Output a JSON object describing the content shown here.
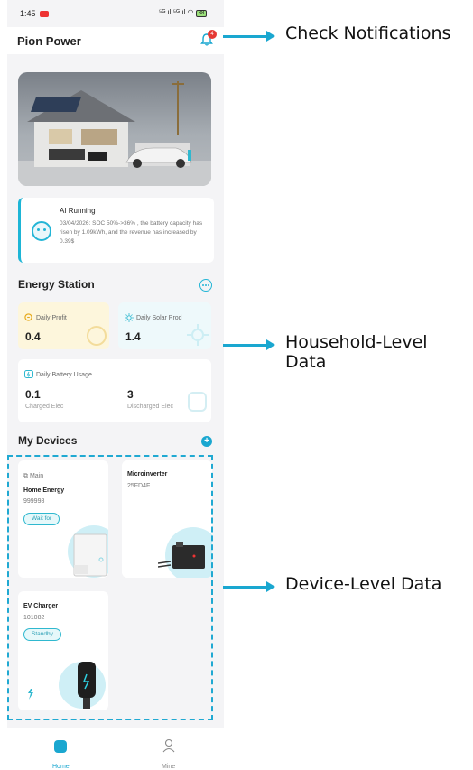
{
  "status_bar": {
    "time": "1:45",
    "dots": "···",
    "signal": "⁵ᴳ.ıl ⁵ᴳ.ıl",
    "battery": "38"
  },
  "app": {
    "title": "Pion Power",
    "notification_count": "4"
  },
  "ai": {
    "title": "AI Running",
    "description": "03/04/2026: SOC 50%->36% , the battery capacity has risen by 1.09kWh, and the revenue has increased by 0.39$"
  },
  "energy_station": {
    "title": "Energy Station",
    "daily_profit": {
      "label": "Daily Profit",
      "value": "0.4"
    },
    "daily_solar": {
      "label": "Daily Solar Prod",
      "value": "1.4"
    },
    "battery_usage": {
      "label": "Daily Battery Usage",
      "charged": {
        "value": "0.1",
        "label": "Charged Elec"
      },
      "discharged": {
        "value": "3",
        "label": "Discharged Elec"
      }
    }
  },
  "devices": {
    "title": "My Devices",
    "items": [
      {
        "tag": "Main",
        "name": "Home Energy",
        "sn": "999998",
        "status": "Wait for"
      },
      {
        "name": "Microinverter",
        "sn": "25FD4F"
      },
      {
        "name": "EV Charger",
        "sn": "101082",
        "status": "Standby"
      }
    ]
  },
  "nav": {
    "home": "Home",
    "mine": "Mine"
  },
  "callouts": {
    "notifications": "Check Notifications",
    "household": "Household-Level Data",
    "device": "Device-Level Data"
  },
  "colors": {
    "accent": "#1aa7d0",
    "profit_bg": "#fdf6dc",
    "solar_bg": "#eef9fb",
    "alert": "#e53935"
  }
}
